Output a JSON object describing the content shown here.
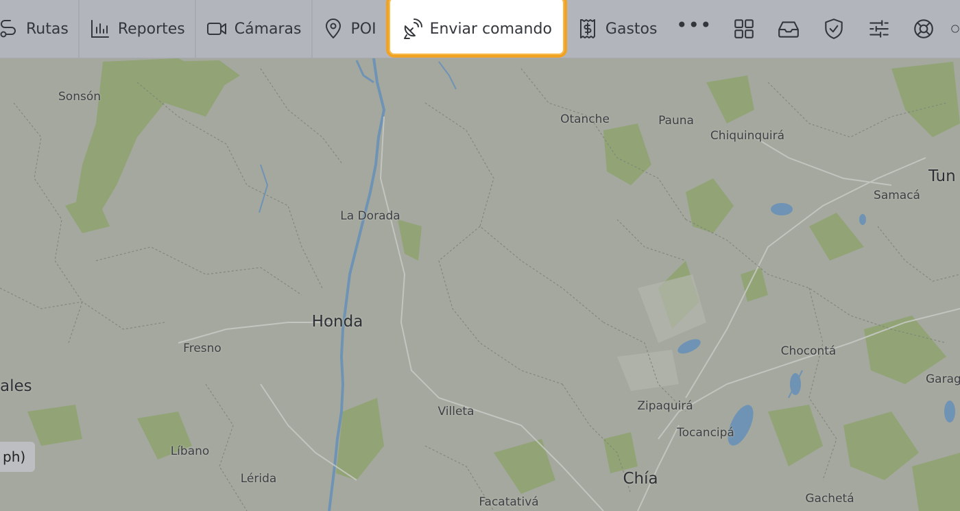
{
  "toolbar": {
    "items": [
      {
        "label": "Rutas",
        "icon": "route-icon"
      },
      {
        "label": "Reportes",
        "icon": "bar-chart-icon"
      },
      {
        "label": "Cámaras",
        "icon": "video-camera-icon"
      },
      {
        "label": "POI",
        "icon": "map-pin-icon"
      },
      {
        "label": "Enviar comando",
        "icon": "satellite-dish-icon",
        "active": true
      },
      {
        "label": "Gastos",
        "icon": "receipt-dollar-icon"
      }
    ],
    "more": "•••",
    "icons": [
      "dashboard-grid-icon",
      "inbox-icon",
      "shield-check-icon",
      "sliders-icon",
      "lifebuoy-icon"
    ],
    "highlight_color": "#f0a223"
  },
  "map": {
    "places": [
      {
        "name": "Sonsón"
      },
      {
        "name": "Otanche"
      },
      {
        "name": "Pauna"
      },
      {
        "name": "Chiquinquirá"
      },
      {
        "name": "Tun"
      },
      {
        "name": "Samacá"
      },
      {
        "name": "La Dorada"
      },
      {
        "name": "Honda"
      },
      {
        "name": "Fresno"
      },
      {
        "name": "ales"
      },
      {
        "name": "Chocontá"
      },
      {
        "name": "Garag"
      },
      {
        "name": "Villeta"
      },
      {
        "name": "Zipaquirá"
      },
      {
        "name": "Tocancipá"
      },
      {
        "name": "Líbano"
      },
      {
        "name": "Lérida"
      },
      {
        "name": "Chía"
      },
      {
        "name": "Facatativá"
      },
      {
        "name": "Gachetá"
      }
    ],
    "speed_chip": "ph)"
  }
}
